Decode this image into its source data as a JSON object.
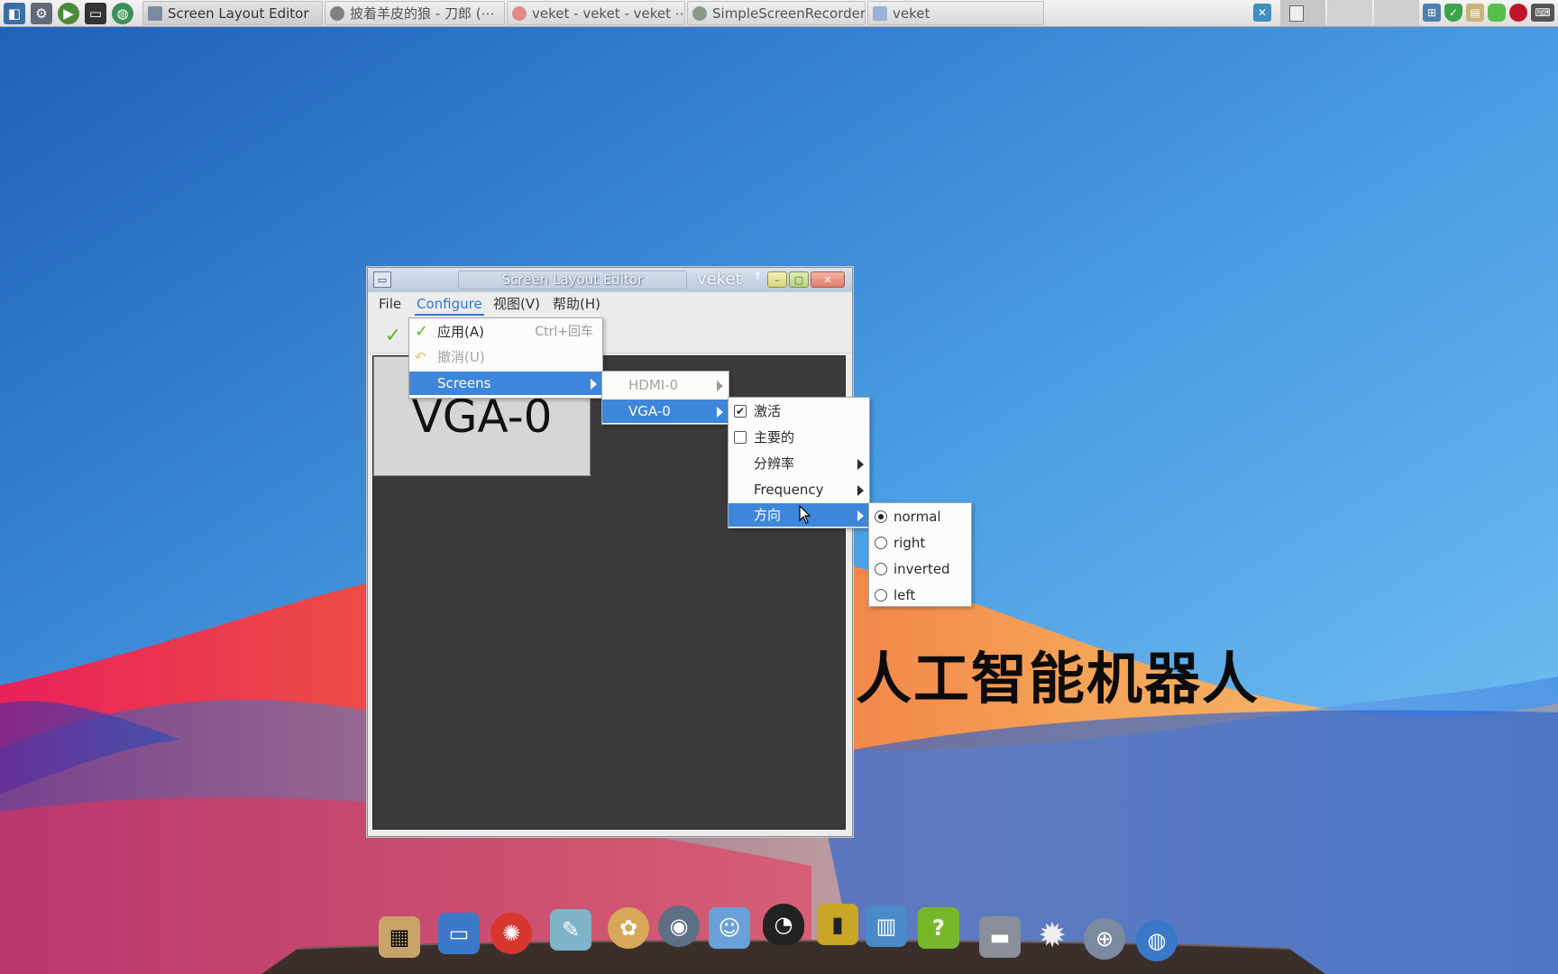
{
  "taskbar": {
    "launchers": [
      {
        "icon": "system-monitor-icon",
        "color": "#3a6ea5"
      },
      {
        "icon": "settings-tools-icon",
        "color": "#5f6b78"
      },
      {
        "icon": "play-icon",
        "color": "#4c8b3a"
      },
      {
        "icon": "terminal-icon",
        "color": "#333333"
      },
      {
        "icon": "globe-icon",
        "color": "#3d8f5a"
      }
    ],
    "tasks": [
      {
        "label": "Screen Layout Editor",
        "icon": "display-icon",
        "icon_color": "#7a8aa0"
      },
      {
        "label": "披着羊皮的狼 - 刀郎 (⋯",
        "icon": "music-player-icon",
        "icon_color": "#808080"
      },
      {
        "label": "veket - veket - veket ⋯",
        "icon": "browser-icon",
        "icon_color": "#e08a8a"
      },
      {
        "label": "SimpleScreenRecorder",
        "icon": "recorder-icon",
        "icon_color": "#8a9a8a"
      },
      {
        "label": "veket",
        "icon": "folder-icon",
        "icon_color": "#9ab3d6"
      }
    ],
    "tray": [
      {
        "icon": "network-icon",
        "color": "#4f7fb0"
      },
      {
        "icon": "shield-icon",
        "color": "#3ea34a"
      },
      {
        "icon": "clipboard-icon",
        "color": "#c9b57a"
      },
      {
        "icon": "database-icon",
        "color": "#56c04a"
      },
      {
        "icon": "record-icon",
        "color": "#c0152a"
      },
      {
        "icon": "keyboard-icon",
        "color": "#555555"
      }
    ]
  },
  "window": {
    "title": "Screen Layout Editor",
    "brand": "veket",
    "brand_arrow": "↑",
    "menubar": [
      "File",
      "Configure",
      "视图(V)",
      "帮助(H)"
    ],
    "screen_label": "VGA-0"
  },
  "configure_menu": {
    "items": [
      {
        "label": "应用(A)",
        "accel": "Ctrl+回车",
        "state": "normal",
        "icon": "check-icon"
      },
      {
        "label": "撤消(U)",
        "accel": "",
        "state": "disabled",
        "icon": "undo-icon"
      },
      {
        "label": "Screens",
        "accel": "",
        "state": "highlighted",
        "icon": ""
      }
    ]
  },
  "screens_menu": {
    "items": [
      {
        "label": "HDMI-0",
        "state": "disabled"
      },
      {
        "label": "VGA-0",
        "state": "highlighted"
      }
    ]
  },
  "vga_menu": {
    "items": [
      {
        "label": "激活",
        "type": "checkbox",
        "checked": true
      },
      {
        "label": "主要的",
        "type": "checkbox",
        "checked": false
      },
      {
        "label": "分辨率",
        "type": "submenu"
      },
      {
        "label": "Frequency",
        "type": "submenu"
      },
      {
        "label": "方向",
        "type": "submenu",
        "highlighted": true
      }
    ]
  },
  "orientation_menu": {
    "selected": "normal",
    "items": [
      "normal",
      "right",
      "inverted",
      "left"
    ]
  },
  "desktop": {
    "caption": "人工智能机器人"
  },
  "dock": {
    "icons": [
      {
        "icon": "file-manager-icon",
        "color": "#c9a46a"
      },
      {
        "icon": "monitor-icon",
        "color": "#3c78c8"
      },
      {
        "icon": "hedgehog-icon",
        "color": "#d9362f"
      },
      {
        "icon": "notes-icon",
        "color": "#7fb3c9"
      },
      {
        "icon": "paint-palette-icon",
        "color": "#d8a85a"
      },
      {
        "icon": "speaker-icon",
        "color": "#5d6f84"
      },
      {
        "icon": "contacts-icon",
        "color": "#6aa0d8"
      },
      {
        "icon": "penguin-icon",
        "color": "#222222"
      },
      {
        "icon": "book-icon",
        "color": "#c9a626"
      },
      {
        "icon": "chart-icon",
        "color": "#4a8ac8"
      },
      {
        "icon": "help-icon",
        "color": "#77b82b"
      },
      {
        "icon": "drive-icon",
        "color": "#8a8f99"
      },
      {
        "icon": "sun-icon",
        "color": "#eeeeee"
      },
      {
        "icon": "network-globe-icon",
        "color": "#7c8aa0"
      },
      {
        "icon": "browser-globe-icon",
        "color": "#3a78c8"
      }
    ]
  }
}
